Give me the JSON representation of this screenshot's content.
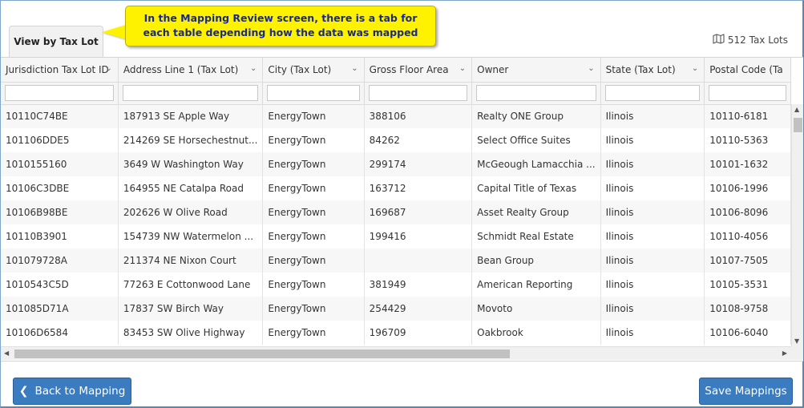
{
  "tab": {
    "label": "View by Tax Lot"
  },
  "callout": {
    "line1": "In the Mapping Review screen, there is a tab for",
    "line2": "each table depending how the data was mapped"
  },
  "record_count": "512 Tax Lots",
  "icons": {
    "count": "map-icon",
    "sort": "chevron-down-icon",
    "back": "chevron-left-icon"
  },
  "colors": {
    "button": "#3b7bbf",
    "callout": "#fff200",
    "callout_text": "#1a2a8c"
  },
  "columns": [
    "Jurisdiction Tax Lot ID",
    "Address Line 1 (Tax Lot)",
    "City (Tax Lot)",
    "Gross Floor Area",
    "Owner",
    "State (Tax Lot)",
    "Postal Code (Ta"
  ],
  "rows": [
    [
      "10110C74BE",
      "187913 SE Apple Way",
      "EnergyTown",
      "388106",
      "Realty ONE Group",
      "Ilinois",
      "10110-6181"
    ],
    [
      "101106DDE5",
      "214269 SE Horsechestnut...",
      "EnergyTown",
      "84262",
      "Select Office Suites",
      "Ilinois",
      "10110-5363"
    ],
    [
      "1010155160",
      "3649 W Washington Way",
      "EnergyTown",
      "299174",
      "McGeough Lamacchia ...",
      "Ilinois",
      "10101-1632"
    ],
    [
      "10106C3DBE",
      "164955 NE Catalpa Road",
      "EnergyTown",
      "163712",
      "Capital Title of Texas",
      "Ilinois",
      "10106-1996"
    ],
    [
      "10106B98BE",
      "202626 W Olive Road",
      "EnergyTown",
      "169687",
      "Asset Realty Group",
      "Ilinois",
      "10106-8096"
    ],
    [
      "10110B3901",
      "154739 NW Watermelon ...",
      "EnergyTown",
      "199416",
      "Schmidt Real Estate",
      "Ilinois",
      "10110-4056"
    ],
    [
      "101079728A",
      "211374 NE Nixon Court",
      "EnergyTown",
      "",
      "Bean Group",
      "Ilinois",
      "10107-7505"
    ],
    [
      "1010543C5D",
      "77263 E Cottonwood Lane",
      "EnergyTown",
      "381949",
      "American Reporting",
      "Ilinois",
      "10105-3531"
    ],
    [
      "101085D71A",
      "17837 SW Birch Way",
      "EnergyTown",
      "254429",
      "Movoto",
      "Ilinois",
      "10108-9758"
    ],
    [
      "10106D6584",
      "83453 SW Olive Highway",
      "EnergyTown",
      "196709",
      "Oakbrook",
      "Ilinois",
      "10106-6040"
    ]
  ],
  "buttons": {
    "back": "Back to Mapping",
    "save": "Save Mappings"
  }
}
